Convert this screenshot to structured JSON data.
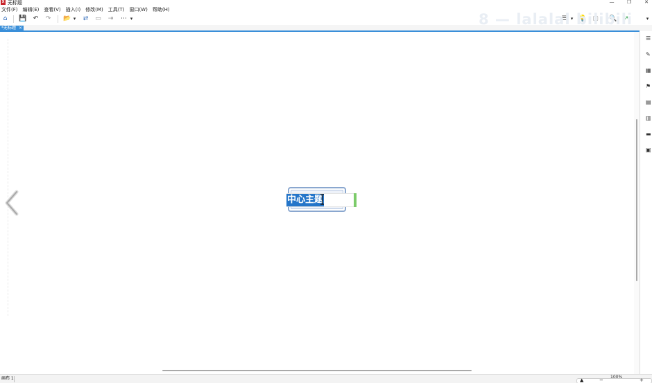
{
  "window": {
    "title": "无标题",
    "app_icon_label": "X",
    "minimize_glyph": "—",
    "restore_glyph": "❐",
    "close_glyph": "✕"
  },
  "menu": [
    {
      "label": "文件(F)"
    },
    {
      "label": "编辑(E)"
    },
    {
      "label": "查看(V)"
    },
    {
      "label": "插入(I)"
    },
    {
      "label": "修改(M)"
    },
    {
      "label": "工具(T)"
    },
    {
      "label": "窗口(W)"
    },
    {
      "label": "帮助(H)"
    }
  ],
  "toolbar": {
    "home": "⌂",
    "save": "💾",
    "undo": "↶",
    "redo": "↷",
    "open_folder": "📂",
    "dropdown": "▾",
    "swap": "⇄",
    "image": "▭",
    "export": "⇥",
    "more": "⋯",
    "dropdown2": "▾",
    "layout": "☰",
    "dropdown3": "▾",
    "bulb": "💡",
    "square": "▢",
    "search": "🔍",
    "share": "↗",
    "dropdown4": "▾"
  },
  "tabs": [
    {
      "label": "*无标题",
      "close": "×"
    }
  ],
  "canvas": {
    "nav_prev": "‹",
    "topic": {
      "text": "中心主题"
    }
  },
  "watermark": "8 — lalalal  bilibili",
  "right_panel_icons": [
    {
      "name": "outline-icon",
      "glyph": "☰"
    },
    {
      "name": "format-icon",
      "glyph": "✎"
    },
    {
      "name": "picture-icon",
      "glyph": "▦"
    },
    {
      "name": "flag-icon",
      "glyph": "⚑"
    },
    {
      "name": "clipart-icon",
      "glyph": "▤"
    },
    {
      "name": "notes-icon",
      "glyph": "▥"
    },
    {
      "name": "comment-icon",
      "glyph": "▬"
    },
    {
      "name": "task-icon",
      "glyph": "▣"
    }
  ],
  "status": {
    "sheet_label": "画布 1",
    "zoom": "100%",
    "zoom_out": "−",
    "zoom_in": "+",
    "filter": "▲"
  },
  "colors": {
    "accent": "#3a8fd9",
    "selection": "#2475c9",
    "caret": "#7ccb6a"
  }
}
